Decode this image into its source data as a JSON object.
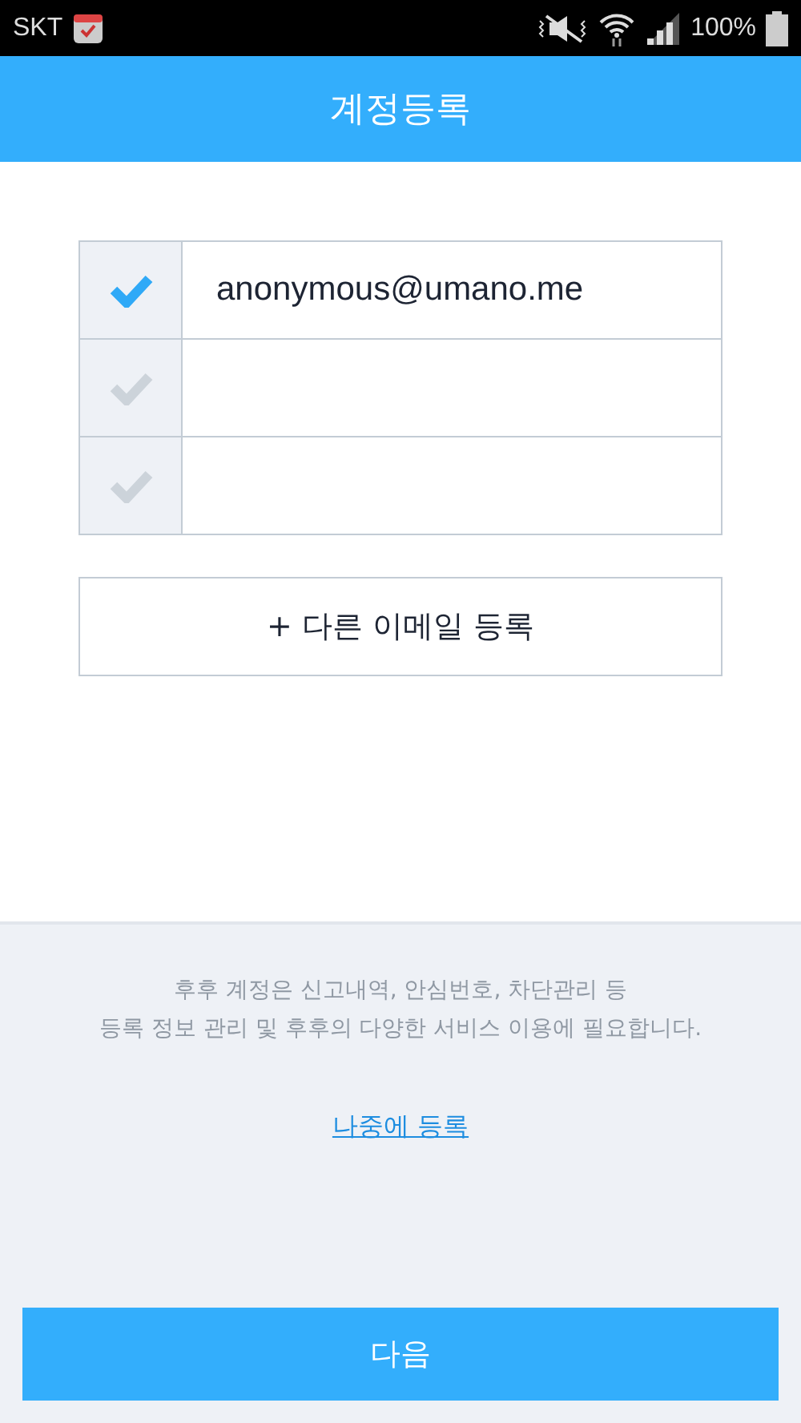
{
  "status_bar": {
    "carrier": "SKT",
    "battery": "100%"
  },
  "header": {
    "title": "계정등록"
  },
  "accounts": [
    {
      "email": "anonymous@umano.me",
      "selected": true
    },
    {
      "selected": false
    },
    {
      "selected": false
    }
  ],
  "add_button": "+ 다른 이메일 등록",
  "info_lines": [
    "후후 계정은 신고내역, 안심번호, 차단관리 등",
    "등록 정보 관리 및 후후의 다양한 서비스 이용에 필요합니다."
  ],
  "later_link": "나중에 등록",
  "next_button": "다음"
}
